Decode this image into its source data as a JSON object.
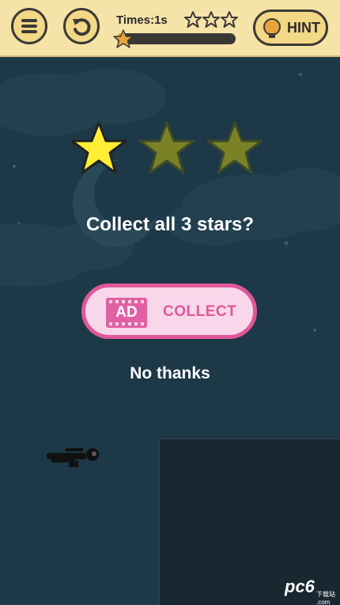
{
  "top_bar": {
    "menu_icon": "hamburger-menu-icon",
    "restart_icon": "restart-arrow-icon",
    "times_text": "Times:1s",
    "mini_stars_earned": 3,
    "mini_stars_total": 3,
    "progress_fraction": 0.06,
    "hint_icon": "lightbulb-icon",
    "hint_label": "HINT"
  },
  "reward_dialog": {
    "stars_earned": 1,
    "stars_total": 3,
    "question": "Collect all 3 stars?",
    "collect_button": {
      "badge_label": "AD",
      "label": "COLLECT"
    },
    "decline_label": "No thanks"
  },
  "watermark": {
    "text": "pc6",
    "subtext": "下载站 .com"
  },
  "colors": {
    "star_filled": "#ffee33",
    "star_empty": "#7b8126",
    "background": "#1d3847",
    "top_bar": "#f6e3a8",
    "collect_border": "#e0579a",
    "collect_fill": "#f8d7ea"
  }
}
